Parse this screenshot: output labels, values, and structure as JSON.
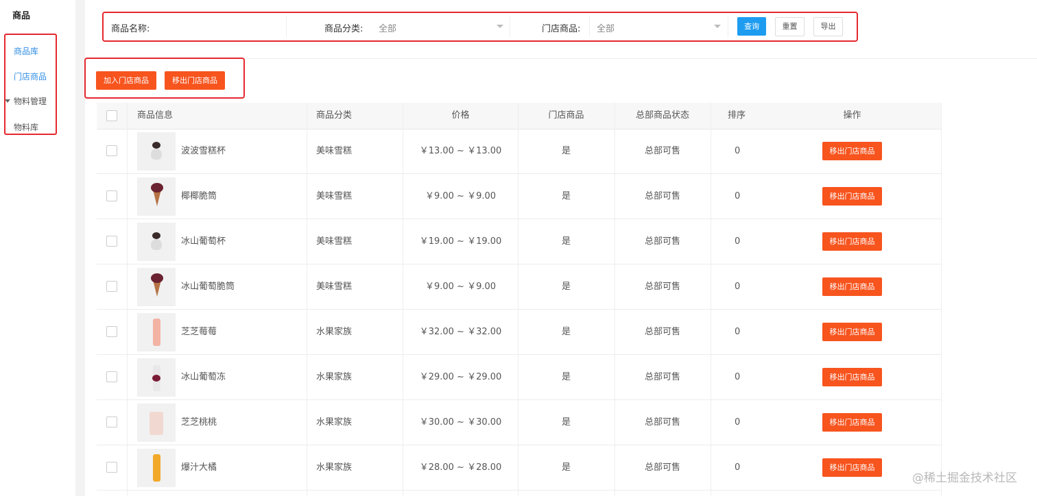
{
  "sidebar": {
    "title": "商品",
    "items": [
      {
        "label": "商品库"
      },
      {
        "label": "门店商品"
      },
      {
        "label": "物料管理"
      },
      {
        "label": "物料库"
      }
    ]
  },
  "filters": {
    "name_label": "商品名称:",
    "category_label": "商品分类:",
    "category_value": "全部",
    "store_label": "门店商品:",
    "store_value": "全部",
    "query": "查询",
    "reset": "重置",
    "export": "导出"
  },
  "actions": {
    "add": "加入门店商品",
    "remove": "移出门店商品"
  },
  "table": {
    "headers": [
      "商品信息",
      "商品分类",
      "价格",
      "门店商品",
      "总部商品状态",
      "排序",
      "操作"
    ],
    "rows": [
      {
        "name": "波波雪糕杯",
        "category": "美味雪糕",
        "price": "￥13.00 ~ ￥13.00",
        "store": "是",
        "status": "总部可售",
        "sort": "0",
        "action": "移出门店商品",
        "thumb": "cup"
      },
      {
        "name": "椰椰脆筒",
        "category": "美味雪糕",
        "price": "￥9.00 ~ ￥9.00",
        "store": "是",
        "status": "总部可售",
        "sort": "0",
        "action": "移出门店商品",
        "thumb": "cone"
      },
      {
        "name": "冰山葡萄杯",
        "category": "美味雪糕",
        "price": "￥19.00 ~ ￥19.00",
        "store": "是",
        "status": "总部可售",
        "sort": "0",
        "action": "移出门店商品",
        "thumb": "cup"
      },
      {
        "name": "冰山葡萄脆筒",
        "category": "美味雪糕",
        "price": "￥9.00 ~ ￥9.00",
        "store": "是",
        "status": "总部可售",
        "sort": "0",
        "action": "移出门店商品",
        "thumb": "cone"
      },
      {
        "name": "芝芝莓莓",
        "category": "水果家族",
        "price": "￥32.00 ~ ￥32.00",
        "store": "是",
        "status": "总部可售",
        "sort": "0",
        "action": "移出门店商品",
        "thumb": "bottle"
      },
      {
        "name": "冰山葡萄冻",
        "category": "水果家族",
        "price": "￥29.00 ~ ￥29.00",
        "store": "是",
        "status": "总部可售",
        "sort": "0",
        "action": "移出门店商品",
        "thumb": "bottle2"
      },
      {
        "name": "芝芝桃桃",
        "category": "水果家族",
        "price": "￥30.00 ~ ￥30.00",
        "store": "是",
        "status": "总部可售",
        "sort": "0",
        "action": "移出门店商品",
        "thumb": "cupw"
      },
      {
        "name": "爆汁大橘",
        "category": "水果家族",
        "price": "￥28.00 ~ ￥28.00",
        "store": "是",
        "status": "总部可售",
        "sort": "0",
        "action": "移出门店商品",
        "thumb": "bottle3"
      }
    ]
  },
  "watermark": "@稀土掘金技术社区"
}
